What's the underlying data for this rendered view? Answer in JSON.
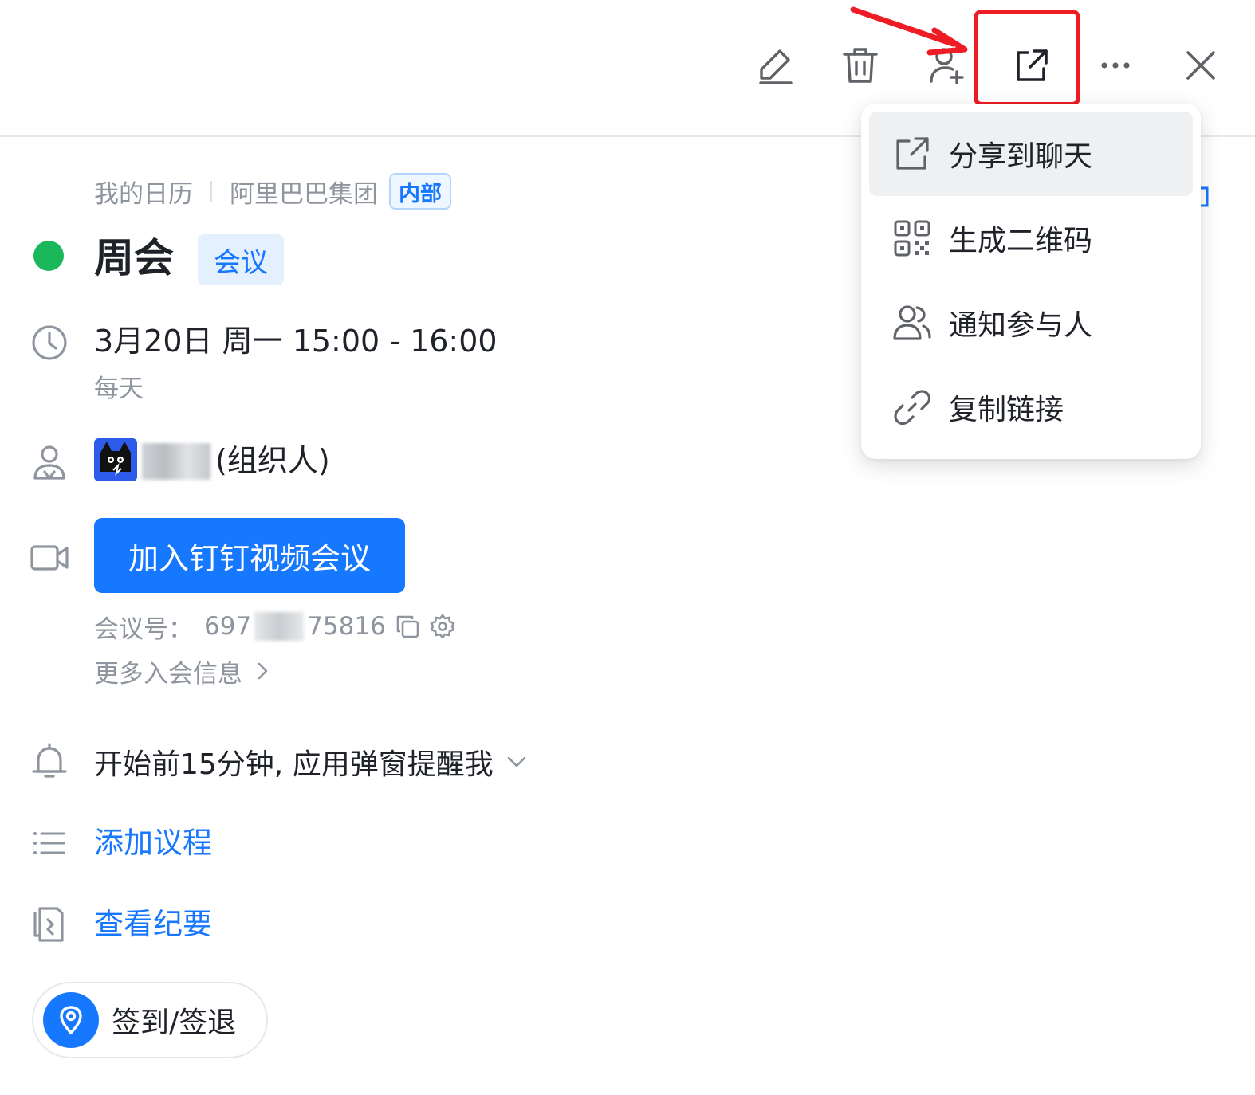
{
  "toolbar": {
    "icons": [
      "edit-icon",
      "delete-icon",
      "add-person-icon",
      "share-icon",
      "more-icon",
      "close-icon"
    ]
  },
  "breadcrumb": {
    "calendar": "我的日历",
    "organization": "阿里巴巴集团",
    "tag": "内部"
  },
  "event": {
    "title": "周会",
    "type_tag": "会议",
    "status_color": "#1ab85a",
    "time": "3月20日 周一 15:00 - 16:00",
    "repeat": "每天",
    "organizer_suffix": "(组织人)",
    "join_button": "加入钉钉视频会议",
    "meeting_no_label": "会议号：",
    "meeting_no_start": "697",
    "meeting_no_end": "75816",
    "more_info": "更多入会信息",
    "reminder": "开始前15分钟, 应用弹窗提醒我",
    "add_agenda": "添加议程",
    "view_minutes": "查看纪要",
    "checkin": "签到/签退"
  },
  "dropdown": {
    "items": [
      {
        "label": "分享到聊天",
        "icon": "share-icon"
      },
      {
        "label": "生成二维码",
        "icon": "qrcode-icon"
      },
      {
        "label": "通知参与人",
        "icon": "people-icon"
      },
      {
        "label": "复制链接",
        "icon": "link-icon"
      }
    ]
  },
  "colors": {
    "accent": "#1677ff",
    "highlight": "#ee1c25",
    "status_green": "#1ab85a"
  }
}
